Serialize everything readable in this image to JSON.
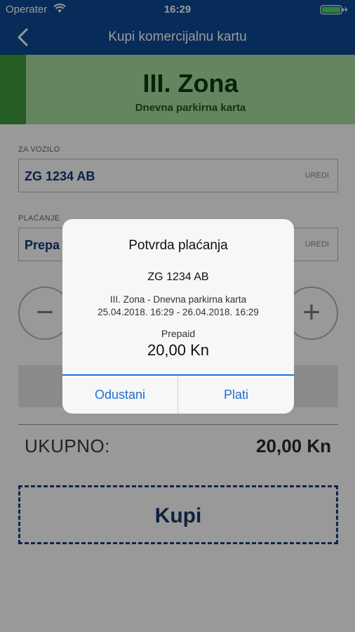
{
  "status_bar": {
    "carrier": "Operater",
    "time": "16:29",
    "wifi_icon": "wifi-icon",
    "battery_icon": "battery-charging-icon"
  },
  "nav": {
    "title": "Kupi komercijalnu kartu",
    "back_icon": "back-chevron-icon"
  },
  "zone": {
    "title": "III. Zona",
    "subtitle": "Dnevna parkirna karta"
  },
  "vehicle": {
    "label": "ZA VOZILO",
    "value": "ZG 1234 AB",
    "action": "UREDI"
  },
  "payment": {
    "label": "PLAĆANJE",
    "value": "Prepa",
    "action": "UREDI"
  },
  "stepper": {
    "minus": "−",
    "plus": "+"
  },
  "total": {
    "label": "UKUPNO:",
    "value": "20,00 Kn"
  },
  "buy_button": {
    "label": "Kupi"
  },
  "dialog": {
    "title": "Potvrda plaćanja",
    "plate": "ZG 1234 AB",
    "zone_line": "III. Zona - Dnevna parkirna karta",
    "range_line": "25.04.2018. 16:29 - 26.04.2018. 16:29",
    "method": "Prepaid",
    "amount": "20,00 Kn",
    "cancel_label": "Odustani",
    "pay_label": "Plati"
  },
  "colors": {
    "header_blue": "#0d4a94",
    "zone_green_light": "#a9dea2",
    "zone_green_dark": "#3e9b3b",
    "dialog_accent": "#1b6fd6"
  }
}
